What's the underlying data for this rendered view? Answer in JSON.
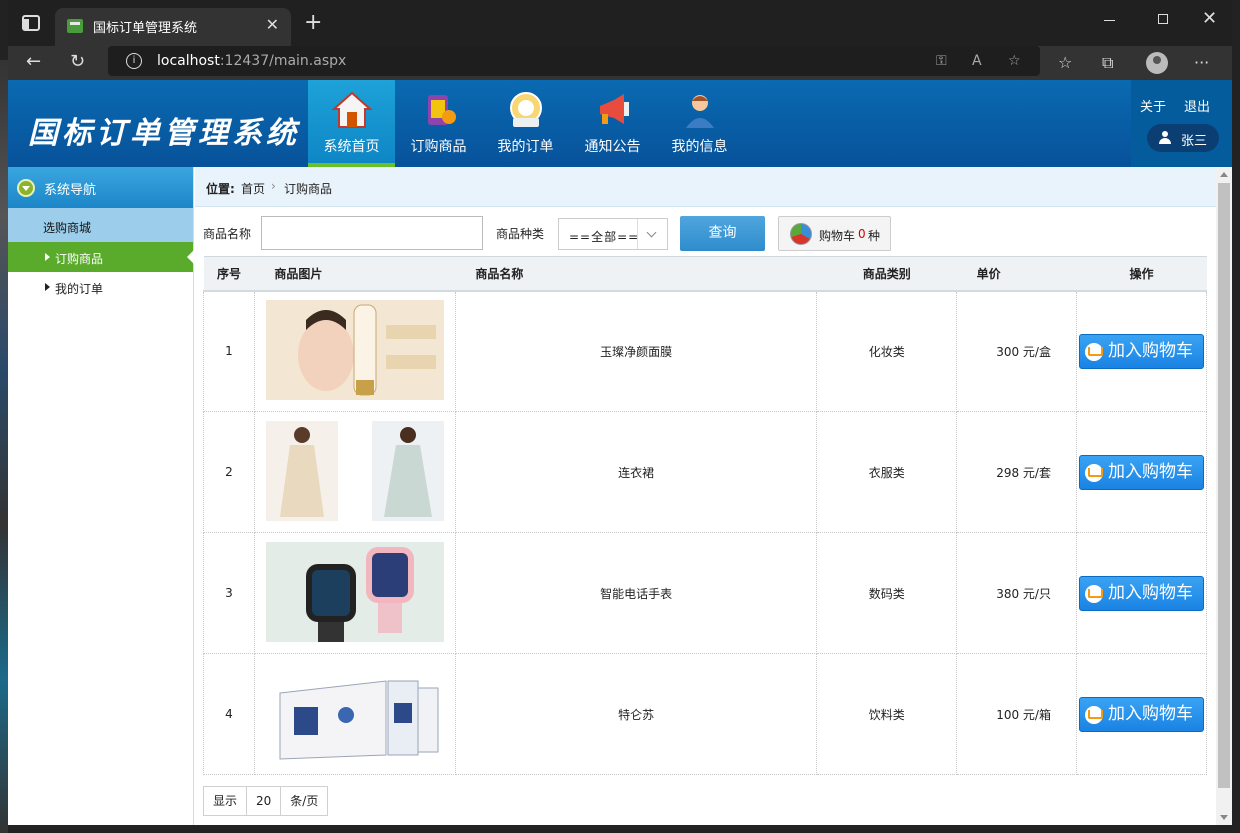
{
  "browser": {
    "tab_title": "国标订单管理系统",
    "url_host": "localhost",
    "url_rest": ":12437/main.aspx"
  },
  "header": {
    "logo": "国标订单管理系统",
    "nav": [
      {
        "label": "系统首页",
        "icon": "home-icon"
      },
      {
        "label": "订购商品",
        "icon": "shopping-icon"
      },
      {
        "label": "我的订单",
        "icon": "order-icon"
      },
      {
        "label": "通知公告",
        "icon": "megaphone-icon"
      },
      {
        "label": "我的信息",
        "icon": "user-profile-icon"
      }
    ],
    "about": "关于",
    "logout": "退出",
    "user": "张三"
  },
  "sidebar": {
    "title": "系统导航",
    "group": "选购商城",
    "items": [
      {
        "label": "订购商品"
      },
      {
        "label": "我的订单"
      }
    ]
  },
  "breadcrumb": {
    "prefix": "位置:",
    "home": "首页",
    "separator": "›",
    "current": "订购商品"
  },
  "filter": {
    "name_label": "商品名称",
    "name_value": "",
    "type_label": "商品种类",
    "type_value": "==全部==",
    "search_button": "查询",
    "cart_label": "购物车",
    "cart_count": "0",
    "cart_unit": "种"
  },
  "table": {
    "headers": [
      "序号",
      "商品图片",
      "商品名称",
      "商品类别",
      "单价",
      "操作"
    ],
    "rows": [
      {
        "no": "1",
        "name": "玉璨净颜面膜",
        "category": "化妆类",
        "price": "300  元/盒",
        "action": "加入购物车"
      },
      {
        "no": "2",
        "name": "连衣裙",
        "category": "衣服类",
        "price": "298  元/套",
        "action": "加入购物车"
      },
      {
        "no": "3",
        "name": "智能电话手表",
        "category": "数码类",
        "price": "380  元/只",
        "action": "加入购物车"
      },
      {
        "no": "4",
        "name": "特仑苏",
        "category": "饮料类",
        "price": "100  元/箱",
        "action": "加入购物车"
      }
    ]
  },
  "pager": {
    "show": "显示",
    "size": "20",
    "unit": "条/页"
  }
}
